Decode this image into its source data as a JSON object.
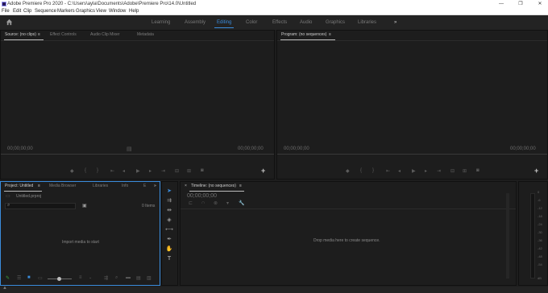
{
  "window": {
    "title": "Adobe Premiere Pro 2020 - C:\\Users\\ayla\\Documents\\Adobe\\Premiere Pro\\14.0\\Untitled",
    "minimize": "—",
    "maximize": "❐",
    "close": "✕"
  },
  "menu": [
    "File",
    "Edit",
    "Clip",
    "Sequence",
    "Markers",
    "Graphics",
    "View",
    "Window",
    "Help"
  ],
  "workspaces": {
    "items": [
      "Learning",
      "Assembly",
      "Editing",
      "Color",
      "Effects",
      "Audio",
      "Graphics",
      "Libraries"
    ],
    "active": "Editing",
    "overflow": "»"
  },
  "source_panel": {
    "tabs": [
      "Source: (no clips)",
      "Effect Controls",
      "Audio Clip Mixer",
      "Metadata"
    ],
    "menu_glyph": "≡",
    "timecode_left": "00;00;00;00",
    "timecode_right": "00;00;00;00",
    "add_glyph": "+"
  },
  "program_panel": {
    "tab": "Program: (no sequences)",
    "menu_glyph": "≡",
    "timecode_left": "00;00;00;00",
    "timecode_right": "00;00;00;00",
    "add_glyph": "+"
  },
  "project_panel": {
    "tabs": [
      "Project: Untitled",
      "Media Browser",
      "Libraries",
      "Info",
      "E"
    ],
    "menu_glyph": "≡",
    "overflow": "»",
    "project_name": "Untitled.prproj",
    "search_placeholder": "",
    "items_label": "0 Items",
    "empty_message": "Import media to start"
  },
  "timeline_panel": {
    "tab": "Timeline: (no sequences)",
    "close_glyph": "×",
    "menu_glyph": "≡",
    "timecode": "00;00;00;00",
    "empty_message": "Drop media here to create sequence."
  },
  "audio_meter": {
    "ticks": [
      "0",
      "-6",
      "-12",
      "-18",
      "-24",
      "-30",
      "-36",
      "-42",
      "-48",
      "-54",
      "dB"
    ]
  },
  "colors": {
    "accent": "#3a8cdc",
    "panel_bg": "#1d1d1d",
    "header_bg": "#232323"
  }
}
